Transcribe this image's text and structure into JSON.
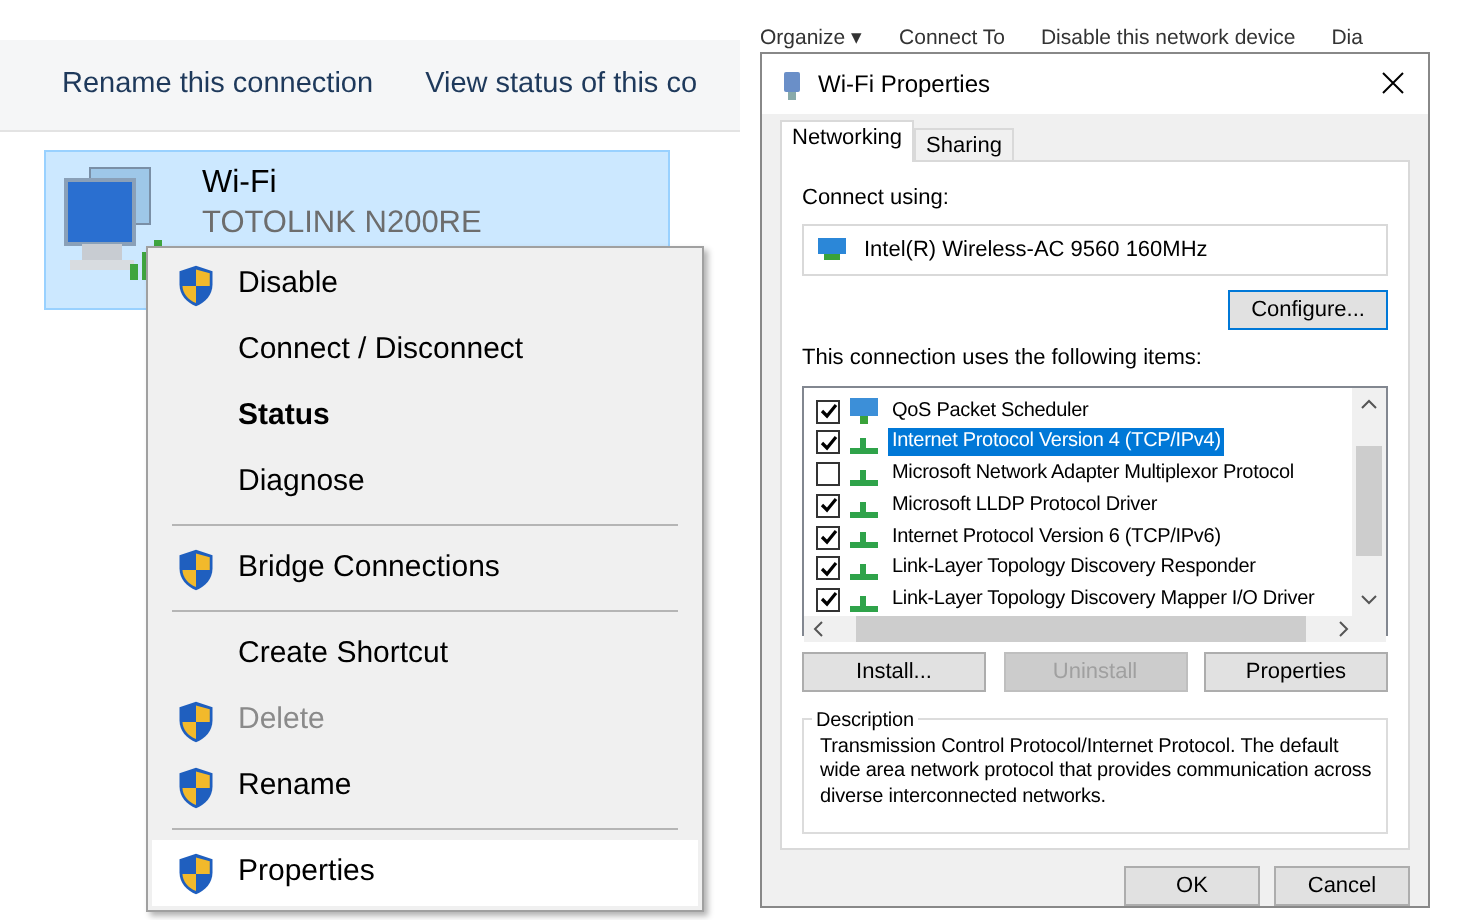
{
  "explorer": {
    "commands": [
      "Rename this connection",
      "View status of this co"
    ],
    "connection": {
      "name": "Wi-Fi",
      "network": "TOTOLINK N200RE",
      "selected": true
    },
    "context_menu": [
      {
        "kind": "item",
        "label": "Disable",
        "shield": true,
        "bold": false,
        "disabled": false,
        "selected": false
      },
      {
        "kind": "item",
        "label": "Connect / Disconnect",
        "shield": false,
        "bold": false,
        "disabled": false,
        "selected": false
      },
      {
        "kind": "item",
        "label": "Status",
        "shield": false,
        "bold": true,
        "disabled": false,
        "selected": false
      },
      {
        "kind": "item",
        "label": "Diagnose",
        "shield": false,
        "bold": false,
        "disabled": false,
        "selected": false
      },
      {
        "kind": "separator"
      },
      {
        "kind": "item",
        "label": "Bridge Connections",
        "shield": true,
        "bold": false,
        "disabled": false,
        "selected": false
      },
      {
        "kind": "separator"
      },
      {
        "kind": "item",
        "label": "Create Shortcut",
        "shield": false,
        "bold": false,
        "disabled": false,
        "selected": false
      },
      {
        "kind": "item",
        "label": "Delete",
        "shield": true,
        "bold": false,
        "disabled": true,
        "selected": false
      },
      {
        "kind": "item",
        "label": "Rename",
        "shield": true,
        "bold": false,
        "disabled": false,
        "selected": false
      },
      {
        "kind": "separator"
      },
      {
        "kind": "item",
        "label": "Properties",
        "shield": true,
        "bold": false,
        "disabled": false,
        "selected": true
      }
    ]
  },
  "dialog": {
    "toolbar_behind": [
      "Organize ▾",
      "Connect To",
      "Disable this network device",
      "Dia"
    ],
    "title": "Wi-Fi Properties",
    "tabs": [
      {
        "label": "Networking",
        "selected": true
      },
      {
        "label": "Sharing",
        "selected": false
      }
    ],
    "connect_using_label": "Connect using:",
    "adapter": "Intel(R) Wireless-AC 9560 160MHz",
    "configure_button": "Configure...",
    "items_label": "This connection uses the following items:",
    "items": [
      {
        "kind": "scheduler",
        "label": "QoS Packet Scheduler",
        "checked": true,
        "selected": false
      },
      {
        "kind": "protocol",
        "label": "Internet Protocol Version 4 (TCP/IPv4)",
        "checked": true,
        "selected": true
      },
      {
        "kind": "protocol",
        "label": "Microsoft Network Adapter Multiplexor Protocol",
        "checked": false,
        "selected": false
      },
      {
        "kind": "protocol",
        "label": "Microsoft LLDP Protocol Driver",
        "checked": true,
        "selected": false
      },
      {
        "kind": "protocol",
        "label": "Internet Protocol Version 6 (TCP/IPv6)",
        "checked": true,
        "selected": false
      },
      {
        "kind": "protocol",
        "label": "Link-Layer Topology Discovery Responder",
        "checked": true,
        "selected": false
      },
      {
        "kind": "protocol",
        "label": "Link-Layer Topology Discovery Mapper I/O Driver",
        "checked": true,
        "selected": false
      }
    ],
    "item_buttons": [
      {
        "label": "Install...",
        "disabled": false
      },
      {
        "label": "Uninstall",
        "disabled": true
      },
      {
        "label": "Properties",
        "disabled": false
      }
    ],
    "description": {
      "legend": "Description",
      "text": "Transmission Control Protocol/Internet Protocol. The default wide area network protocol that provides communication across diverse interconnected networks."
    },
    "footer_buttons": [
      "OK",
      "Cancel"
    ]
  }
}
